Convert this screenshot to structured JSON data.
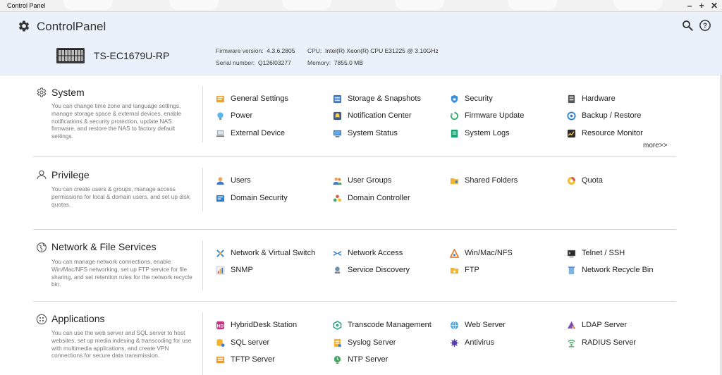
{
  "window": {
    "title": "Control Panel"
  },
  "header": {
    "title": "ControlPanel",
    "model": "TS-EC1679U-RP",
    "firmware_label": "Firmware version:",
    "firmware_value": "4.3.6.2805",
    "serial_label": "Serial number:",
    "serial_value": "Q126I03277",
    "cpu_label": "CPU:",
    "cpu_value": "Intel(R) Xeon(R) CPU E31225 @ 3.10GHz",
    "memory_label": "Memory:",
    "memory_value": "7855.0 MB"
  },
  "sections": {
    "system": {
      "title": "System",
      "icon": "gear-icon",
      "description": "You can change time zone and language settings, manage storage space & external devices, enable notifications & security protection, update NAS firmware, and restore the NAS to factory default settings.",
      "more": "more>>",
      "items": [
        {
          "label": "General Settings",
          "icon": "general-settings-icon"
        },
        {
          "label": "Storage & Snapshots",
          "icon": "storage-icon"
        },
        {
          "label": "Security",
          "icon": "security-icon"
        },
        {
          "label": "Hardware",
          "icon": "hardware-icon"
        },
        {
          "label": "Power",
          "icon": "power-icon"
        },
        {
          "label": "Notification Center",
          "icon": "notification-icon"
        },
        {
          "label": "Firmware Update",
          "icon": "firmware-update-icon"
        },
        {
          "label": "Backup / Restore",
          "icon": "backup-restore-icon"
        },
        {
          "label": "External Device",
          "icon": "external-device-icon"
        },
        {
          "label": "System Status",
          "icon": "system-status-icon"
        },
        {
          "label": "System Logs",
          "icon": "system-logs-icon"
        },
        {
          "label": "Resource Monitor",
          "icon": "resource-monitor-icon"
        }
      ]
    },
    "privilege": {
      "title": "Privilege",
      "icon": "user-icon",
      "description": "You can create users & groups, manage access permissions for local & domain users, and set up disk quotas.",
      "items": [
        {
          "label": "Users",
          "icon": "users-icon"
        },
        {
          "label": "User Groups",
          "icon": "user-groups-icon"
        },
        {
          "label": "Shared Folders",
          "icon": "shared-folders-icon"
        },
        {
          "label": "Quota",
          "icon": "quota-icon"
        },
        {
          "label": "Domain Security",
          "icon": "domain-security-icon"
        },
        {
          "label": "Domain Controller",
          "icon": "domain-controller-icon"
        }
      ]
    },
    "network": {
      "title": "Network & File Services",
      "icon": "globe-icon",
      "description": "You can manage network connections, enable Win/Mac/NFS networking, set up FTP service for file sharing, and set retention rules for the network recycle bin.",
      "items": [
        {
          "label": "Network & Virtual Switch",
          "icon": "network-switch-icon"
        },
        {
          "label": "Network Access",
          "icon": "network-access-icon"
        },
        {
          "label": "Win/Mac/NFS",
          "icon": "win-mac-nfs-icon"
        },
        {
          "label": "Telnet / SSH",
          "icon": "telnet-ssh-icon"
        },
        {
          "label": "SNMP",
          "icon": "snmp-icon"
        },
        {
          "label": "Service Discovery",
          "icon": "service-discovery-icon"
        },
        {
          "label": "FTP",
          "icon": "ftp-icon"
        },
        {
          "label": "Network Recycle Bin",
          "icon": "recycle-bin-icon"
        }
      ]
    },
    "applications": {
      "title": "Applications",
      "icon": "apps-icon",
      "description": "You can use the web server and SQL server to host websites, set up media indexing & transcoding for use with multimedia applications, and create VPN connections for secure data transmission.",
      "items": [
        {
          "label": "HybridDesk Station",
          "icon": "hybriddesk-icon"
        },
        {
          "label": "Transcode Management",
          "icon": "transcode-icon"
        },
        {
          "label": "Web Server",
          "icon": "web-server-icon"
        },
        {
          "label": "LDAP Server",
          "icon": "ldap-server-icon"
        },
        {
          "label": "SQL server",
          "icon": "sql-server-icon"
        },
        {
          "label": "Syslog Server",
          "icon": "syslog-server-icon"
        },
        {
          "label": "Antivirus",
          "icon": "antivirus-icon"
        },
        {
          "label": "RADIUS Server",
          "icon": "radius-server-icon"
        },
        {
          "label": "TFTP Server",
          "icon": "tftp-server-icon"
        },
        {
          "label": "NTP Server",
          "icon": "ntp-server-icon"
        }
      ]
    }
  }
}
